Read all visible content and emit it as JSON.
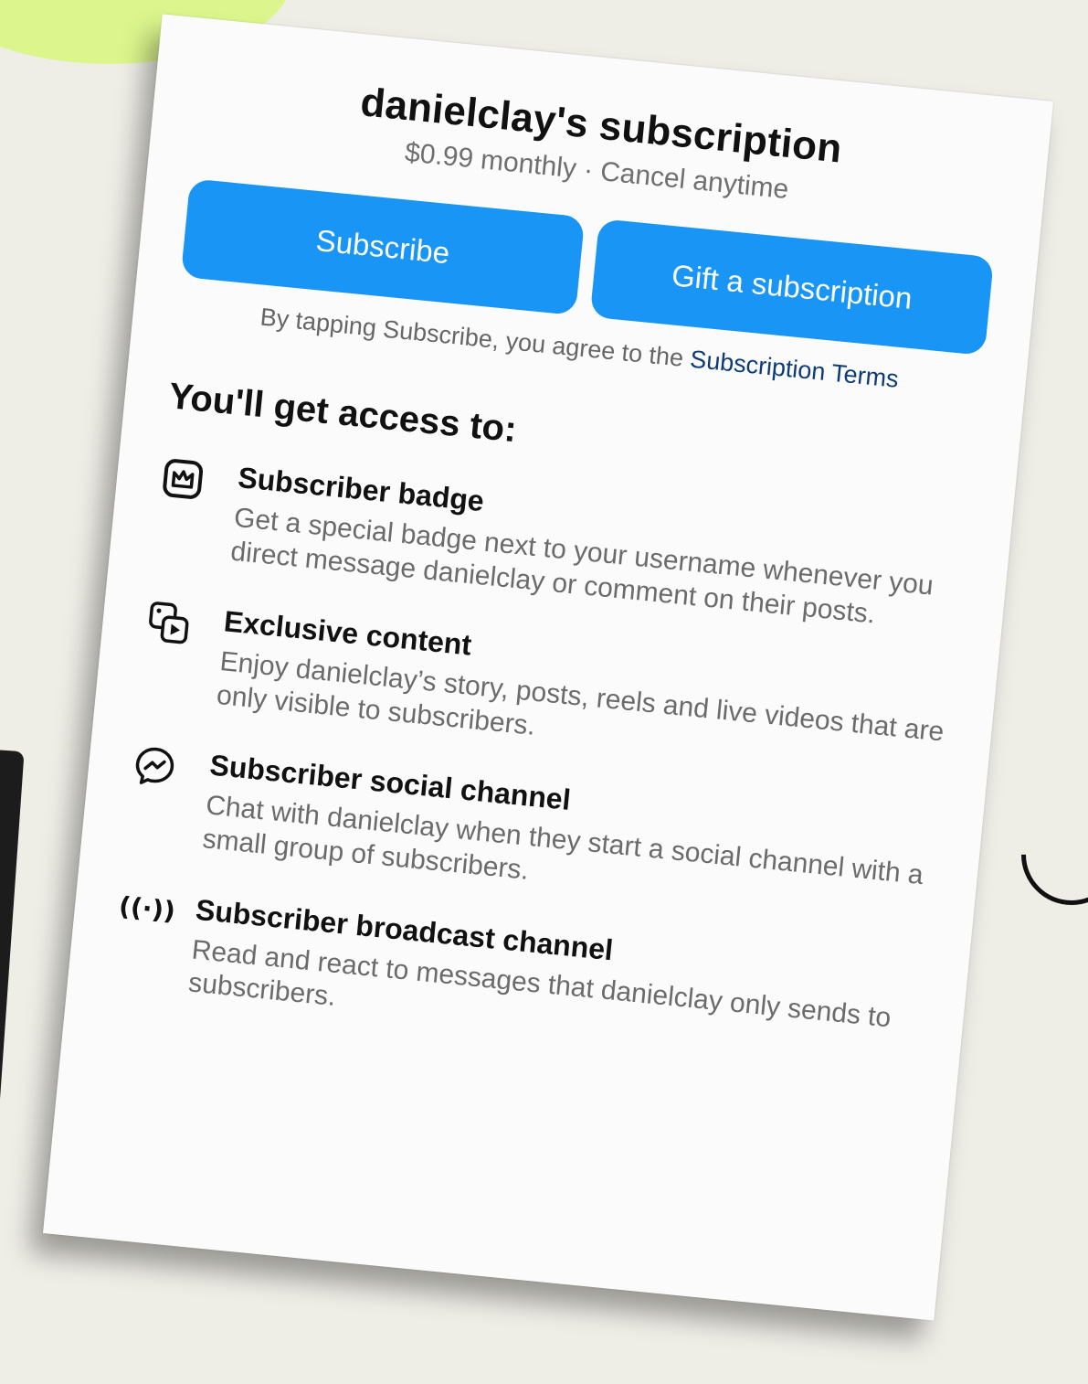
{
  "header": {
    "title": "danielclay's subscription",
    "subtitle": "$0.99 monthly · Cancel anytime"
  },
  "buttons": {
    "subscribe": "Subscribe",
    "gift": "Gift a subscription"
  },
  "terms": {
    "prefix": "By tapping Subscribe, you agree to the",
    "link": "Subscription Terms"
  },
  "access": {
    "heading": "You'll get access to:",
    "items": [
      {
        "icon": "crown-badge-icon",
        "title": "Subscriber badge",
        "description": "Get a special badge next to your username whenever you direct message danielclay or comment on their posts."
      },
      {
        "icon": "photo-video-icon",
        "title": "Exclusive content",
        "description": "Enjoy danielclay’s story, posts, reels and live videos that are only visible to subscribers."
      },
      {
        "icon": "messenger-icon",
        "title": "Subscriber social channel",
        "description": "Chat with danielclay when they start a social channel with a small group of subscribers."
      },
      {
        "icon": "broadcast-icon",
        "icon_text": "((·))",
        "title": "Subscriber broadcast channel",
        "description": "Read and react to messages that danielclay only sends to subscribers."
      }
    ]
  },
  "colors": {
    "background": "#eeede6",
    "accent_blob": "#dcf68d",
    "button_blue": "#1996f5",
    "link_blue": "#0c3a7a"
  }
}
